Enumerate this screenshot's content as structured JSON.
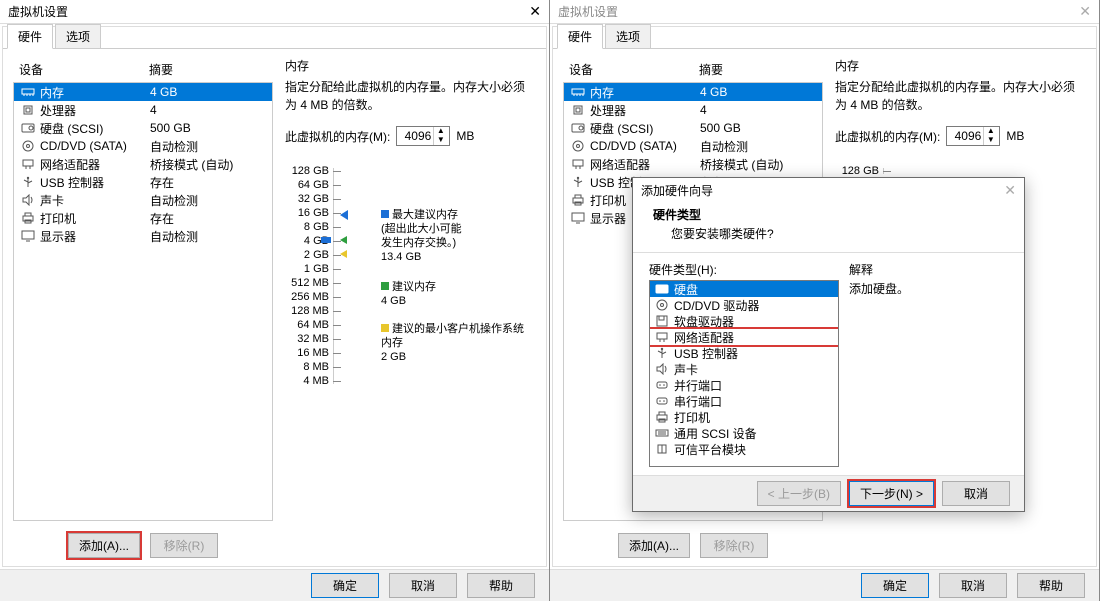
{
  "window_title": "虚拟机设置",
  "tabs": {
    "hardware": "硬件",
    "options": "选项"
  },
  "columns": {
    "device": "设备",
    "summary": "摘要"
  },
  "hardware": [
    {
      "name": "内存",
      "summary": "4 GB",
      "icon": "memory"
    },
    {
      "name": "处理器",
      "summary": "4",
      "icon": "cpu"
    },
    {
      "name": "硬盘 (SCSI)",
      "summary": "500 GB",
      "icon": "disk"
    },
    {
      "name": "CD/DVD (SATA)",
      "summary": "自动检测",
      "icon": "cd"
    },
    {
      "name": "网络适配器",
      "summary": "桥接模式 (自动)",
      "icon": "net"
    },
    {
      "name": "USB 控制器",
      "summary": "存在",
      "icon": "usb"
    },
    {
      "name": "声卡",
      "summary": "自动检测",
      "icon": "sound"
    },
    {
      "name": "打印机",
      "summary": "存在",
      "icon": "printer"
    },
    {
      "name": "显示器",
      "summary": "自动检测",
      "icon": "display"
    }
  ],
  "mem": {
    "title": "内存",
    "desc": "指定分配给此虚拟机的内存量。内存大小必须为 4 MB 的倍数。",
    "label": "此虚拟机的内存(M):",
    "value": "4096",
    "unit": "MB",
    "ladder": [
      "128 GB",
      "64 GB",
      "32 GB",
      "16 GB",
      "8 GB",
      "4 GB",
      "2 GB",
      "1 GB",
      "512 MB",
      "256 MB",
      "128 MB",
      "64 MB",
      "32 MB",
      "16 MB",
      "8 MB",
      "4 MB"
    ],
    "legend": {
      "max": "最大建议内存",
      "max_note1": "(超出此大小可能",
      "max_note2": "发生内存交换。)",
      "max_val": "13.4 GB",
      "rec": "建议内存",
      "rec_val": "4 GB",
      "min": "建议的最小客户机操作系统内存",
      "min_val": "2 GB"
    }
  },
  "buttons": {
    "add": "添加(A)...",
    "remove": "移除(R)",
    "ok": "确定",
    "cancel": "取消",
    "help": "帮助"
  },
  "wizard": {
    "title": "添加硬件向导",
    "head1": "硬件类型",
    "head2": "您要安装哪类硬件?",
    "list_label": "硬件类型(H):",
    "explain_label": "解释",
    "explain_text": "添加硬盘。",
    "items": [
      {
        "name": "硬盘",
        "icon": "disk"
      },
      {
        "name": "CD/DVD 驱动器",
        "icon": "cd"
      },
      {
        "name": "软盘驱动器",
        "icon": "floppy"
      },
      {
        "name": "网络适配器",
        "icon": "net"
      },
      {
        "name": "USB 控制器",
        "icon": "usb"
      },
      {
        "name": "声卡",
        "icon": "sound"
      },
      {
        "name": "并行端口",
        "icon": "port"
      },
      {
        "name": "串行端口",
        "icon": "port"
      },
      {
        "name": "打印机",
        "icon": "printer"
      },
      {
        "name": "通用 SCSI 设备",
        "icon": "scsi"
      },
      {
        "name": "可信平台模块",
        "icon": "tpm"
      }
    ],
    "back": "< 上一步(B)",
    "next": "下一步(N) >",
    "cancel": "取消"
  }
}
